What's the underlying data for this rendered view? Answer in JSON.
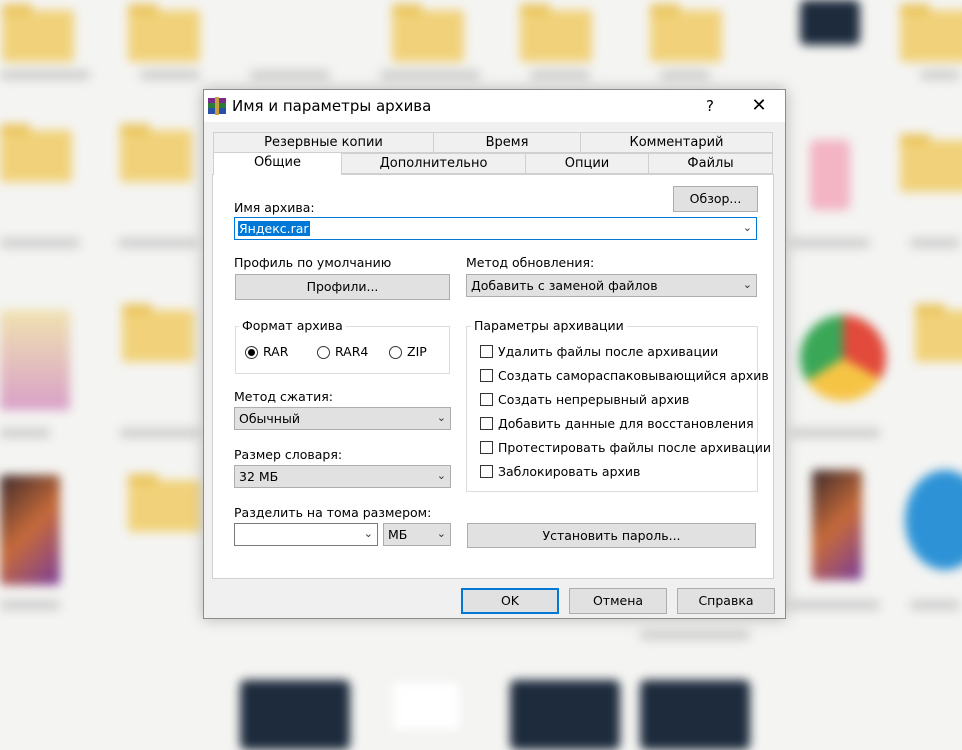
{
  "dialog": {
    "title": "Имя и параметры архива",
    "help_label": "?",
    "close_label": "✕"
  },
  "tabs_top": [
    "Резервные копии",
    "Время",
    "Комментарий"
  ],
  "tabs_bottom": [
    "Общие",
    "Дополнительно",
    "Опции",
    "Файлы"
  ],
  "active_tab": "Общие",
  "archive_name": {
    "label": "Имя архива:",
    "value": "Яндекс.rar",
    "browse_label": "Обзор..."
  },
  "profile": {
    "label": "Профиль по умолчанию",
    "button_label": "Профили..."
  },
  "update_method": {
    "label": "Метод обновления:",
    "value": "Добавить с заменой файлов"
  },
  "format": {
    "title": "Формат архива",
    "options": [
      "RAR",
      "RAR4",
      "ZIP"
    ],
    "selected": "RAR"
  },
  "compression": {
    "label": "Метод сжатия:",
    "value": "Обычный"
  },
  "dictionary": {
    "label": "Размер словаря:",
    "value": "32 МБ"
  },
  "split": {
    "label": "Разделить на тома размером:",
    "value": "",
    "unit": "МБ"
  },
  "options": {
    "title": "Параметры архивации",
    "items": [
      "Удалить файлы после архивации",
      "Создать самораспаковывающийся архив",
      "Создать непрерывный архив",
      "Добавить данные для восстановления",
      "Протестировать файлы после архивации",
      "Заблокировать архив"
    ],
    "checked": [
      false,
      false,
      false,
      false,
      false,
      false
    ]
  },
  "password_button": "Установить пароль...",
  "footer": {
    "ok": "OK",
    "cancel": "Отмена",
    "help": "Справка"
  },
  "colors": {
    "accent": "#0078d7",
    "selection": "#0078d7",
    "button": "#e1e1e1",
    "dialog_bg": "#f0f0f0"
  },
  "icons": {
    "app": "winrar-icon",
    "dropdown": "chevron-down-icon",
    "close": "close-icon"
  }
}
